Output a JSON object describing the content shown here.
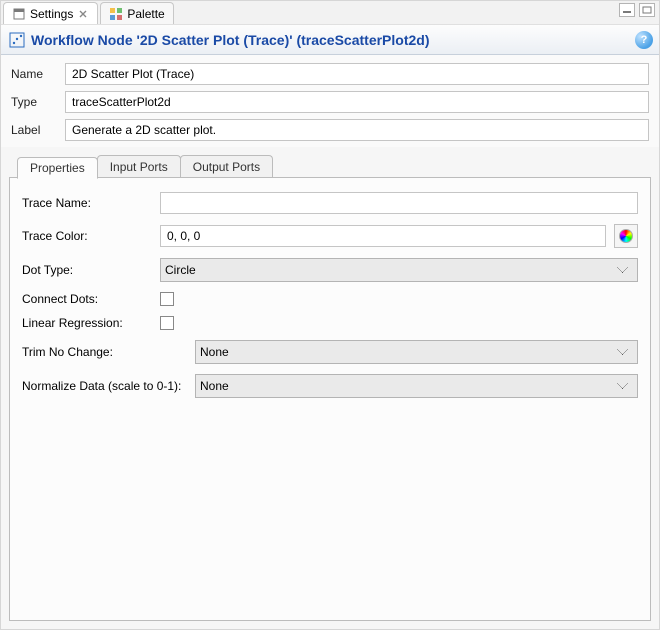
{
  "top_tabs": {
    "settings_label": "Settings",
    "palette_label": "Palette"
  },
  "header": {
    "title": "Workflow Node '2D Scatter Plot (Trace)' (traceScatterPlot2d)"
  },
  "form": {
    "name_label": "Name",
    "name_value": "2D Scatter Plot (Trace)",
    "type_label": "Type",
    "type_value": "traceScatterPlot2d",
    "label_label": "Label",
    "label_value": "Generate a 2D scatter plot."
  },
  "subtabs": {
    "properties": "Properties",
    "input_ports": "Input Ports",
    "output_ports": "Output Ports"
  },
  "properties": {
    "trace_name_label": "Trace Name:",
    "trace_name_value": "",
    "trace_color_label": "Trace Color:",
    "trace_color_value": "0, 0, 0",
    "dot_type_label": "Dot Type:",
    "dot_type_value": "Circle",
    "connect_dots_label": "Connect Dots:",
    "linear_regression_label": "Linear Regression:",
    "trim_no_change_label": "Trim No Change:",
    "trim_no_change_value": "None",
    "normalize_label": "Normalize Data (scale to 0-1):",
    "normalize_value": "None"
  }
}
